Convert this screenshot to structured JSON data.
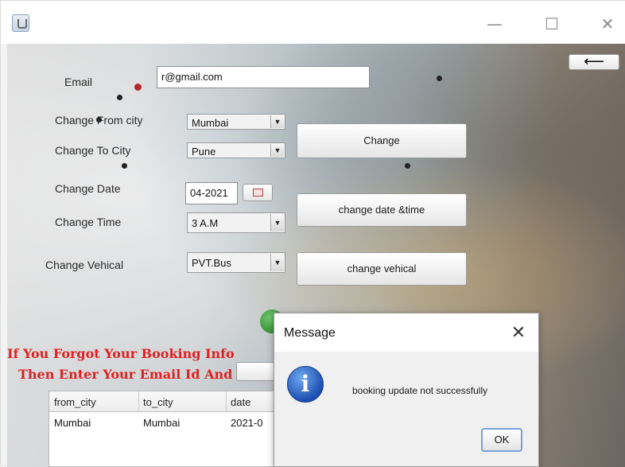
{
  "window": {
    "min_glyph": "—",
    "max_glyph": "☐",
    "close_glyph": "✕"
  },
  "form": {
    "email_label": "Email",
    "email_value": "r@gmail.com",
    "from_city_label": "Change From city",
    "from_city_value": "Mumbai",
    "to_city_label": "Change To City",
    "to_city_value": "Pune",
    "date_label": "Change Date",
    "date_value": "04-2021",
    "time_label": "Change Time",
    "time_value": "3   A.M",
    "vehicle_label": "Change Vehical",
    "vehicle_value": "PVT.Bus",
    "dropdown_glyph": "▼",
    "back_glyph": "⟵"
  },
  "buttons": {
    "change": "Change",
    "change_date_time": "change date &time",
    "change_vehicle": "change vehical"
  },
  "notice": {
    "line1": "If You Forgot Your Booking Info",
    "line2": "Then Enter Your Email Id  And"
  },
  "table": {
    "columns": [
      "from_city",
      "to_city",
      "date"
    ],
    "rows": [
      [
        "Mumbai",
        "Mumbai",
        "2021-0"
      ]
    ]
  },
  "dialog": {
    "title": "Message",
    "close_glyph": "✕",
    "icon_glyph": "i",
    "message": "booking update not successfully",
    "ok": "OK"
  }
}
